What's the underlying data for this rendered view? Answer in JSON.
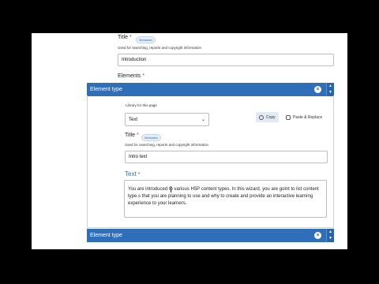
{
  "title_field": {
    "label": "Title",
    "badge": "Metadata",
    "description": "Used for searching, reports and copyright information",
    "value": "Introduction"
  },
  "elements": {
    "label": "Elements",
    "items": [
      {
        "header": "Element type",
        "library_label": "Library for this page",
        "library_value": "Text",
        "copy_label": "Copy",
        "paste_label": "Paste & Replace",
        "title_label": "Title",
        "title_badge": "Metadata",
        "title_description": "Used for searching, reports and copyright information",
        "title_value": "Intro text",
        "text_label": "Text",
        "text_value": "You are introduced to various H5P content types. In this wizard, you are goint to list content type.s that you are planning to use and why to create and provide an interactive learning experience to your learners."
      },
      {
        "header": "Element type"
      }
    ]
  },
  "colors": {
    "accent": "#2f6fba",
    "required": "#c0392b",
    "text_label": "#2f6fba"
  }
}
